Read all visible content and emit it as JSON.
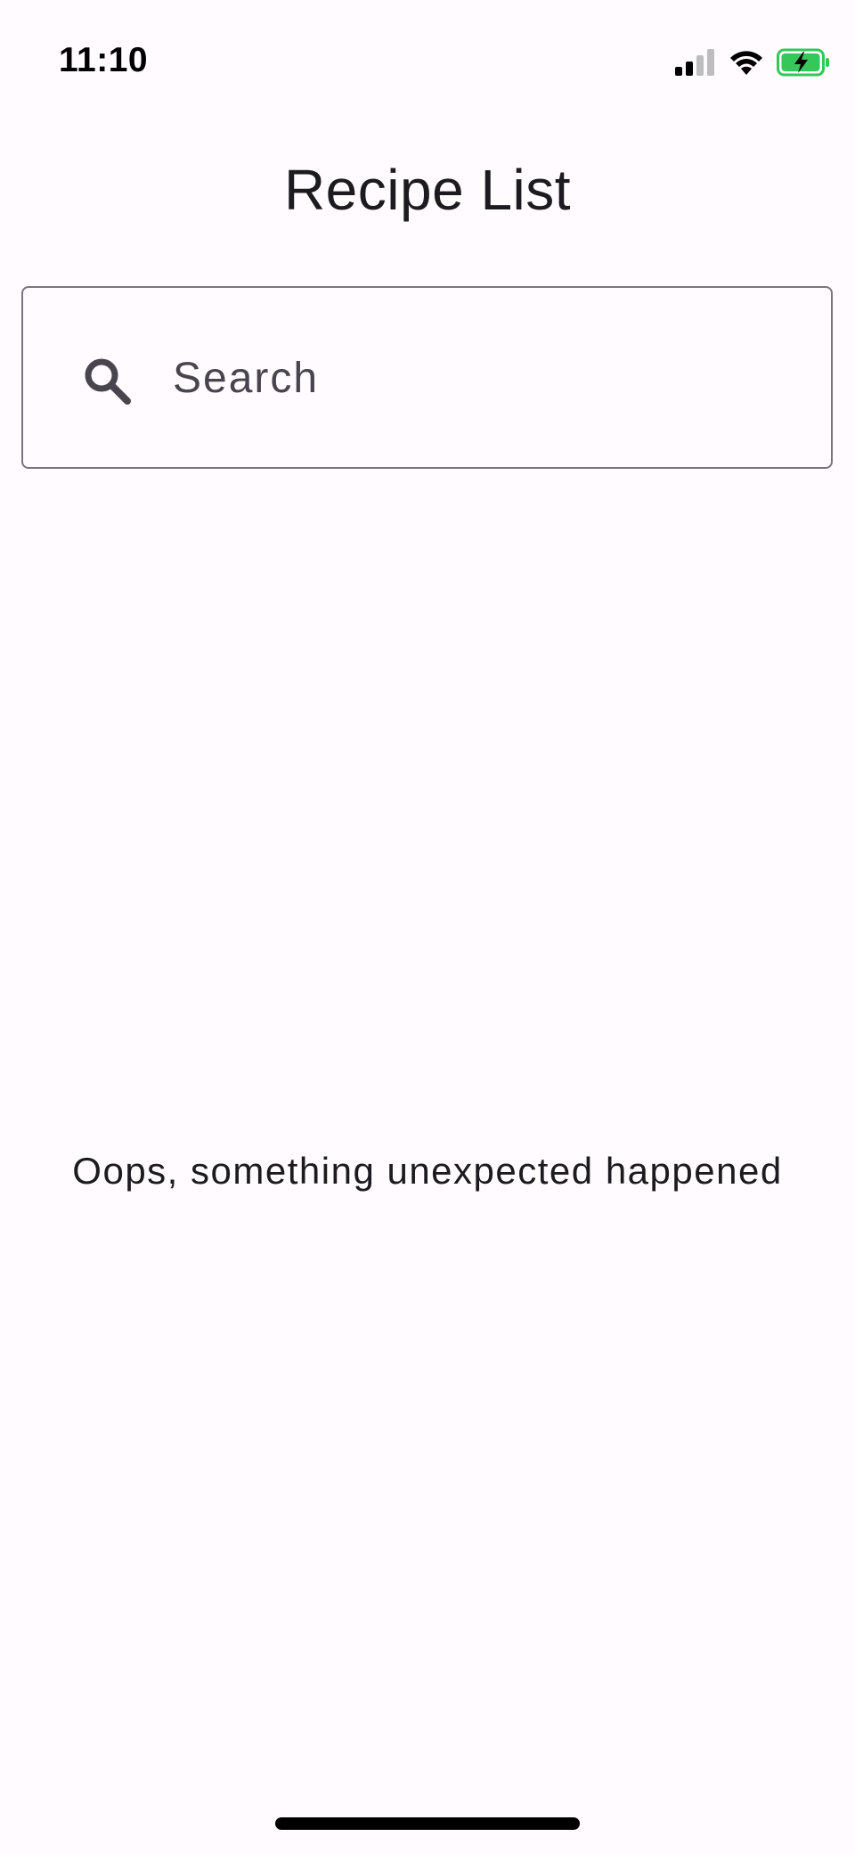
{
  "status_bar": {
    "time": "11:10",
    "signal_icon": "cellular-signal-icon",
    "wifi_icon": "wifi-icon",
    "battery_icon": "battery-charging-icon",
    "battery_color": "#34C759"
  },
  "header": {
    "title": "Recipe List"
  },
  "search": {
    "placeholder": "Search",
    "value": "",
    "icon": "search-icon"
  },
  "main": {
    "error_message": "Oops, something unexpected happened"
  },
  "colors": {
    "background": "#FFFBFE",
    "outline": "#79747E",
    "on_surface": "#1C1B1F",
    "on_surface_variant": "#49454F"
  }
}
